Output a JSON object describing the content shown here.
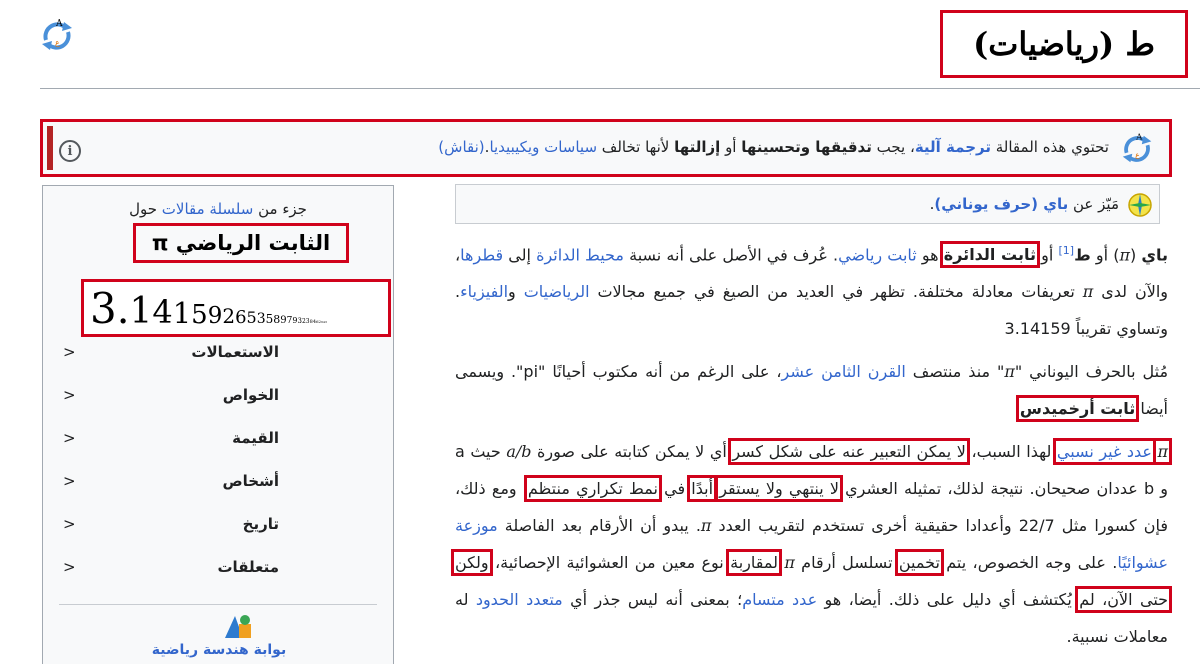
{
  "header": {
    "title": "ط (رياضيات)",
    "logo_icon": "machine-translation-icon"
  },
  "ambox": {
    "text_pre": "تحتوي هذه المقالة ",
    "link_mt": "ترجمة آلية",
    "text_mid1": "، يجب ",
    "bold1": "تدقيقها وتحسينها",
    "text_mid2": " أو ",
    "bold2": "إزالتها",
    "text_mid3": " لأنها تخالف ",
    "link_policy": "سياسات ويكيبيديا",
    "text_mid4": ".",
    "link_talk": "(نقاش)",
    "info_icon": "info-icon",
    "accent_color": "#b32424"
  },
  "infobox": {
    "part_of_pre": "جزء من ",
    "part_of_link": "سلسلة مقالات",
    "part_of_post": " حول",
    "title": "الثابت الرياضي π",
    "pi_digits": [
      {
        "d": "3",
        "s": 42
      },
      {
        "d": ".",
        "s": 40
      },
      {
        "d": "1",
        "s": 36
      },
      {
        "d": "4",
        "s": 32
      },
      {
        "d": "1",
        "s": 29
      },
      {
        "d": "5",
        "s": 26
      },
      {
        "d": "9",
        "s": 23
      },
      {
        "d": "2",
        "s": 20
      },
      {
        "d": "6",
        "s": 18
      },
      {
        "d": "5",
        "s": 16
      },
      {
        "d": "3",
        "s": 14
      },
      {
        "d": "5",
        "s": 12
      },
      {
        "d": "8",
        "s": 11
      },
      {
        "d": "9",
        "s": 10
      },
      {
        "d": "7",
        "s": 9
      },
      {
        "d": "9",
        "s": 8
      },
      {
        "d": "3",
        "s": 7
      },
      {
        "d": "2",
        "s": 6
      },
      {
        "d": "3",
        "s": 6
      },
      {
        "d": "8",
        "s": 5
      },
      {
        "d": "4",
        "s": 5
      },
      {
        "d": "6",
        "s": 4
      },
      {
        "d": "2",
        "s": 4
      },
      {
        "d": "6",
        "s": 3
      },
      {
        "d": "4",
        "s": 3
      },
      {
        "d": "3",
        "s": 3
      }
    ],
    "rows": [
      {
        "label": "الاستعمالات",
        "chevron": ">"
      },
      {
        "label": "الخواص",
        "chevron": ">"
      },
      {
        "label": "القيمة",
        "chevron": ">"
      },
      {
        "label": "أشخاص",
        "chevron": ">"
      },
      {
        "label": "تاريخ",
        "chevron": ">"
      },
      {
        "label": "متعلقات",
        "chevron": ">"
      }
    ],
    "portal_icon": "geometry-portal-icon",
    "portal_link": "بوابة هندسة رياضية"
  },
  "hatnote": {
    "icon": "disambiguation-compass-icon",
    "text_pre": "مَيّز عن ",
    "link": "باي (حرف يوناني)",
    "text_post": "."
  },
  "article": {
    "p1": [
      {
        "t": "باي",
        "b": true
      },
      {
        "t": " ("
      },
      {
        "t": "π",
        "m": true
      },
      {
        "t": ") أو "
      },
      {
        "t": "ط",
        "b": true
      },
      {
        "t": "[1]",
        "sup": true
      },
      {
        "t": " أو "
      },
      {
        "t": "ثابت الدائرة",
        "b": true,
        "hl": true
      },
      {
        "t": " هو "
      },
      {
        "t": "ثابت رياضي",
        "link": true
      },
      {
        "t": ". عُرف في الأصل على أنه نسبة "
      },
      {
        "t": "محيط الدائرة",
        "link": true
      },
      {
        "t": " إلى "
      },
      {
        "t": "قطرها",
        "link": true
      },
      {
        "t": "، والآن لدى "
      },
      {
        "t": "π",
        "m": true
      },
      {
        "t": " تعريفات معادلة مختلفة. تظهر في العديد من الصيغ في جميع مجالات "
      },
      {
        "t": "الرياضيات",
        "link": true
      },
      {
        "t": " و"
      },
      {
        "t": "الفيزياء",
        "link": true
      },
      {
        "t": ". وتساوي تقريباً 3.14159"
      }
    ],
    "p2": [
      {
        "t": "مُثل بالحرف اليوناني \""
      },
      {
        "t": "π",
        "m": true
      },
      {
        "t": "\" منذ منتصف "
      },
      {
        "t": "القرن الثامن عشر",
        "link": true
      },
      {
        "t": "، على الرغم من أنه مكتوب أحيانًا \"pi\". ويسمى أيضا "
      },
      {
        "t": "ثابت أرخميدس",
        "b": true,
        "hl": true
      },
      {
        "t": "."
      }
    ],
    "p3": [
      {
        "t": "π",
        "m": true,
        "hl": true
      },
      {
        "t": " "
      },
      {
        "t": "عدد غير نسبي",
        "link": true,
        "hl": true
      },
      {
        "t": " لهذا السبب، "
      },
      {
        "t": "لا يمكن التعبير عنه على شكل كسر",
        "hl": true
      },
      {
        "t": " أي لا يمكن كتابته على صورة "
      },
      {
        "t": "a/b",
        "m": true
      },
      {
        "t": " حيث a و b عددان صحيحان. نتيجة لذلك، تمثيله العشري "
      },
      {
        "t": "لا ينتهي ولا يستقر",
        "hl": true
      },
      {
        "t": " "
      },
      {
        "t": "أبدًا",
        "hl": true
      },
      {
        "t": " في "
      },
      {
        "t": "نمط تكراري منتظم",
        "hl": true
      },
      {
        "t": ". ومع ذلك، فإن كسورا مثل 22/7 وأعدادا حقيقية أخرى تستخدم لتقريب العدد "
      },
      {
        "t": "π",
        "m": true
      },
      {
        "t": ". يبدو أن الأرقام بعد الفاصلة "
      },
      {
        "t": "موزعة عشوائيًا",
        "link": true
      },
      {
        "t": ". على وجه الخصوص، يتم "
      },
      {
        "t": "تخمين",
        "hl": true
      },
      {
        "t": " تسلسل أرقام "
      },
      {
        "t": "π",
        "m": true
      },
      {
        "t": " "
      },
      {
        "t": "لمقاربة",
        "hl": true
      },
      {
        "t": " نوع معين من العشوائية الإحصائية، "
      },
      {
        "t": "ولكن حتى الآن، لم",
        "hl": true
      },
      {
        "t": " يُكتشف أي دليل على ذلك. أيضا، هو "
      },
      {
        "t": "عدد متسام",
        "link": true
      },
      {
        "t": "؛ بمعنى أنه ليس جذر أي "
      },
      {
        "t": "متعدد الحدود",
        "link": true
      },
      {
        "t": " له معاملات نسبية."
      }
    ]
  },
  "colors": {
    "link": "#3366cc",
    "highlight": "#d0021b",
    "text": "#202122"
  }
}
